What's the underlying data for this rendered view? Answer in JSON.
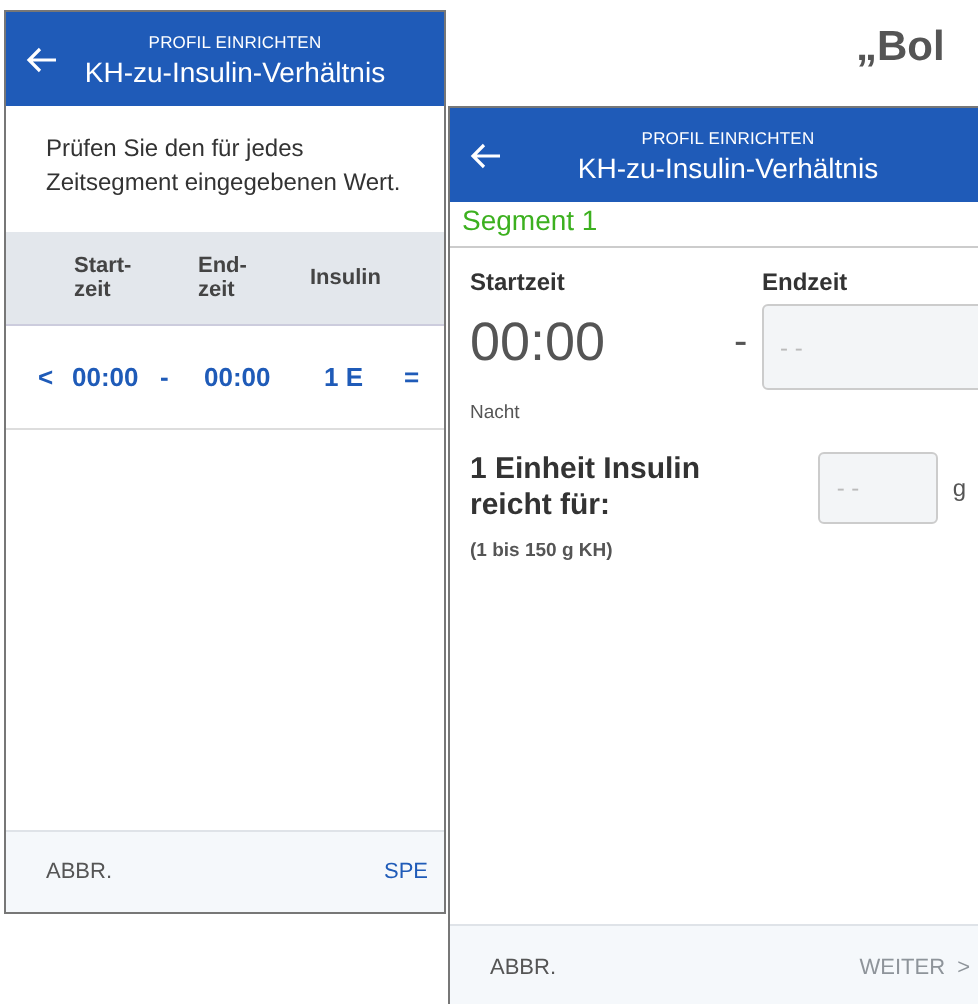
{
  "background_text": "„Bol",
  "review_screen": {
    "header": {
      "subtitle": "PROFIL EINRICHTEN",
      "title": "KH-zu-Insulin-Verhältnis"
    },
    "instruction": "Prüfen Sie den für jedes Zeitsegment eingegebenen Wert.",
    "table": {
      "columns": [
        "Start-zeit",
        "End-zeit",
        "Insulin"
      ],
      "rows": [
        {
          "arrow": "<",
          "start": "00:00",
          "separator": "-",
          "end": "00:00",
          "insulin": "1 E",
          "equals": "="
        }
      ]
    },
    "footer": [
      {
        "label": "ABBR.",
        "disabled": false,
        "primary": false
      },
      {
        "label": "SPE",
        "disabled": false,
        "primary": true
      }
    ]
  },
  "segment_screen": {
    "header": {
      "subtitle": "PROFIL EINRICHTEN",
      "title": "KH-zu-Insulin-Verhältnis"
    },
    "segment": "Segment 1",
    "start_label": "Startzeit",
    "end_label": "Endzeit",
    "start_value": "00:00",
    "separator": "-",
    "end_placeholder": "- -",
    "period": "Nacht",
    "ratio_label": "1 Einheit Insulin reicht für:",
    "ratio_placeholder": "- -",
    "ratio_unit": "g",
    "ratio_hint": "(1 bis 150 g KH)",
    "footer": [
      {
        "label": "ABBR.",
        "disabled": false,
        "primary": false
      },
      {
        "label": "WEITER",
        "disabled": true,
        "primary": false,
        "chevron": ">"
      }
    ]
  }
}
